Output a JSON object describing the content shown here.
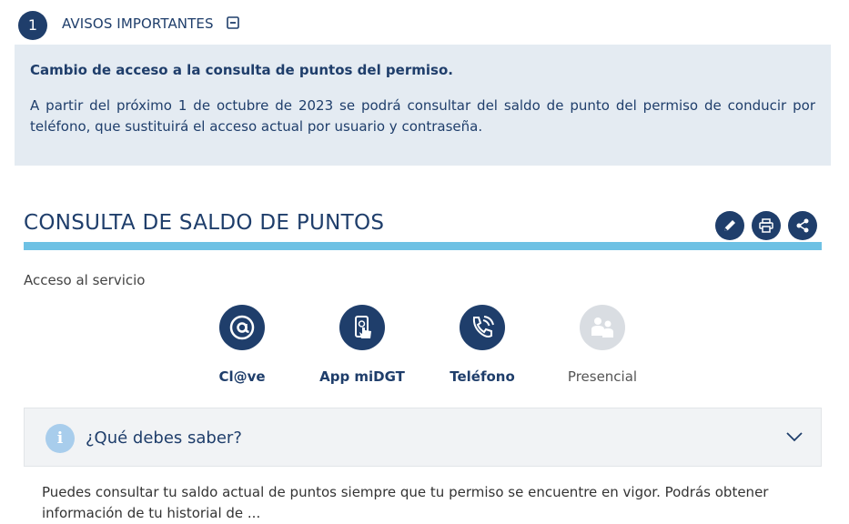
{
  "notice": {
    "number": "1",
    "title": "AVISOS IMPORTANTES",
    "subtitle": "Cambio de acceso a la consulta de puntos del permiso.",
    "body": "A partir del próximo 1 de octubre de 2023 se podrá consultar del saldo de punto del permiso de conducir por teléfono, que sustituirá el acceso actual por usuario y contraseña."
  },
  "section": {
    "title": "CONSULTA DE SALDO DE PUNTOS",
    "tools": [
      "edit-icon",
      "print-icon",
      "share-icon"
    ]
  },
  "access": {
    "label": "Acceso al servicio",
    "options": [
      {
        "label": "Cl@ve",
        "icon": "at-sign-icon",
        "enabled": true
      },
      {
        "label": "App miDGT",
        "icon": "mobile-touch-icon",
        "enabled": true
      },
      {
        "label": "Teléfono",
        "icon": "phone-icon",
        "enabled": true
      },
      {
        "label": "Presencial",
        "icon": "people-icon",
        "enabled": false
      }
    ]
  },
  "accordion": {
    "icon": "i",
    "title": "¿Qué debes saber?"
  },
  "info_text": "Puedes consultar tu saldo actual de puntos siempre que tu permiso se encuentre en vigor. Podrás obtener información de tu historial de ...",
  "colors": {
    "primary": "#1f3e6b",
    "accent_bar": "#6ec1e4",
    "notice_bg": "#e4ebf2",
    "disabled": "#d9dde2"
  }
}
